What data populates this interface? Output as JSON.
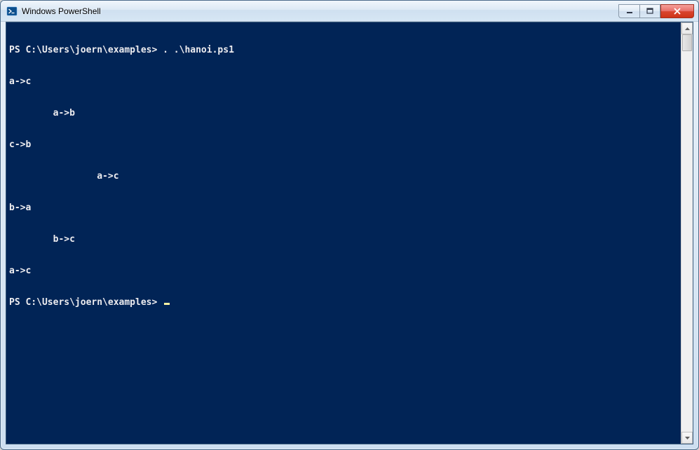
{
  "window": {
    "title": "Windows PowerShell"
  },
  "terminal": {
    "lines": [
      "PS C:\\Users\\joern\\examples> . .\\hanoi.ps1",
      "a->c",
      "        a->b",
      "c->b",
      "                a->c",
      "b->a",
      "        b->c",
      "a->c"
    ],
    "prompt": "PS C:\\Users\\joern\\examples> "
  },
  "colors": {
    "terminal_bg": "#012456",
    "terminal_fg": "#eeedf0",
    "cursor": "#fdf3a2"
  }
}
